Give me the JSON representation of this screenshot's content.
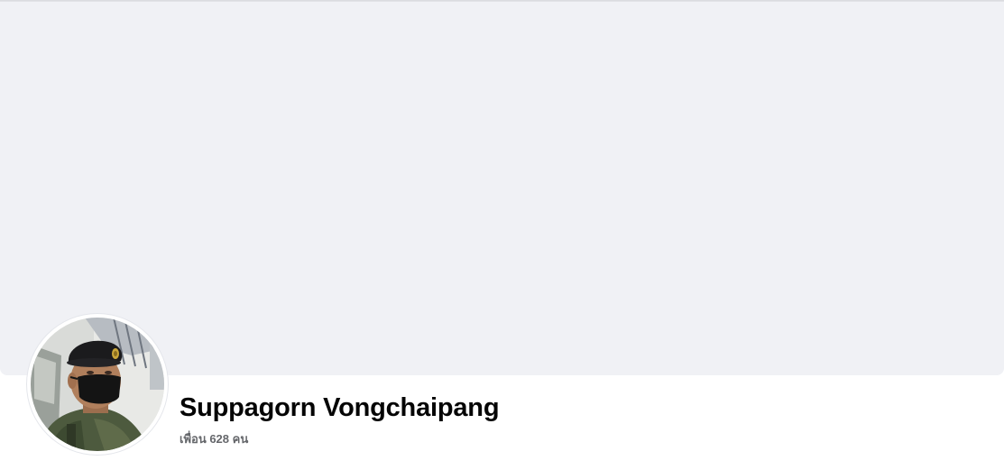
{
  "profile": {
    "name": "Suppagorn Vongchaipang",
    "friends_text": "เพื่อน 628 คน"
  },
  "colors": {
    "cover_background": "#f0f1f5",
    "name_text": "#050505",
    "secondary_text": "#65676b"
  },
  "icons": {
    "avatar": "profile-photo"
  }
}
